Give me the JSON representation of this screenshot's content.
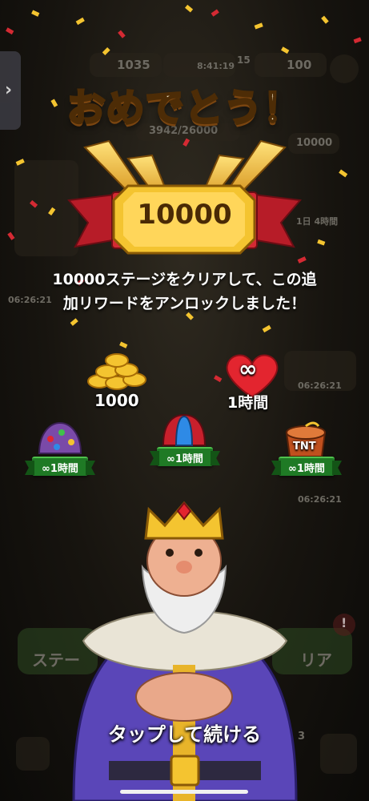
{
  "background_hud": {
    "coins": "1035",
    "timer": "8:41:19",
    "lives_count": "15",
    "gems": "100",
    "progress": "3942/26000",
    "bank": "10000",
    "event_timer_1": "06:26:21",
    "event_timer_2": "06:26:21",
    "event_timer_3": "06:26:21",
    "event_label": "1日 4時間",
    "play_button_left": "ステー",
    "play_button_right": "リア",
    "bottom_count": "3",
    "alert": "!"
  },
  "side_tab": {
    "arrow": "›"
  },
  "title": "おめでとう！",
  "stage_badge": {
    "value": "10000"
  },
  "message": {
    "line1": "10000ステージをクリアして、この追",
    "line2": "加リワードをアンロックしました！"
  },
  "rewards": {
    "coins": {
      "amount": "1000",
      "icon": "coin-stack-icon"
    },
    "lives": {
      "duration": "1時間",
      "symbol": "∞",
      "icon": "heart-infinity-icon"
    },
    "boosters": [
      {
        "icon": "candy-bomb-icon",
        "symbol": "∞",
        "duration": "1時間"
      },
      {
        "icon": "helmet-booster-icon",
        "symbol": "∞",
        "duration": "1時間"
      },
      {
        "icon": "tnt-barrel-icon",
        "label": "TNT",
        "symbol": "∞",
        "duration": "1時間"
      }
    ]
  },
  "tap_to_continue": "タップして続ける",
  "colors": {
    "gold": "#f7c431",
    "ribbon_red": "#c8202c",
    "ribbon_green": "#1f7a25",
    "robe_purple": "#5a46b8",
    "heart_red": "#e3252f"
  }
}
